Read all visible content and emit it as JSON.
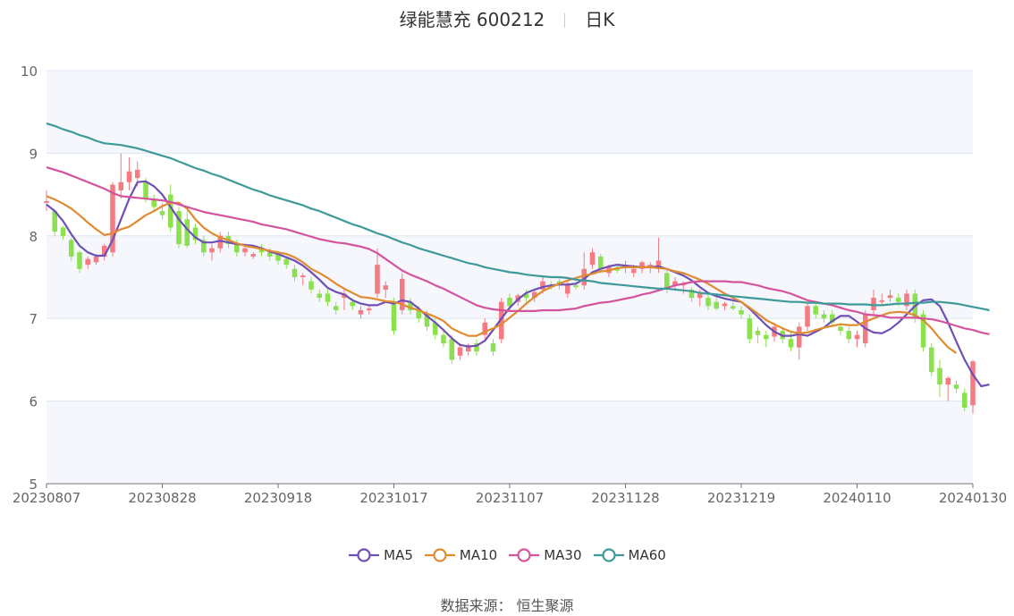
{
  "title": {
    "name": "绿能慧充 600212",
    "period": "日K"
  },
  "source": {
    "label": "数据来源：",
    "value": "恒生聚源"
  },
  "chart_data": {
    "type": "candlestick",
    "ylim": [
      5,
      10
    ],
    "yticks": [
      5,
      6,
      7,
      8,
      9,
      10
    ],
    "xtick_labels": [
      "20230807",
      "20230828",
      "20230918",
      "20231017",
      "20231107",
      "20231128",
      "20231219",
      "20240110",
      "20240130"
    ],
    "candles_ohlc": [
      [
        8.4,
        8.55,
        8.3,
        8.42
      ],
      [
        8.3,
        8.32,
        8.0,
        8.05
      ],
      [
        8.1,
        8.12,
        7.95,
        8.0
      ],
      [
        7.95,
        7.98,
        7.7,
        7.75
      ],
      [
        7.8,
        7.82,
        7.55,
        7.6
      ],
      [
        7.65,
        7.75,
        7.6,
        7.72
      ],
      [
        7.68,
        7.78,
        7.65,
        7.75
      ],
      [
        7.75,
        7.9,
        7.7,
        7.88
      ],
      [
        7.8,
        8.65,
        7.75,
        8.62
      ],
      [
        8.55,
        9.0,
        8.45,
        8.65
      ],
      [
        8.65,
        8.95,
        8.55,
        8.78
      ],
      [
        8.7,
        8.9,
        8.6,
        8.8
      ],
      [
        8.65,
        8.7,
        8.4,
        8.45
      ],
      [
        8.45,
        8.5,
        8.3,
        8.35
      ],
      [
        8.3,
        8.4,
        8.2,
        8.25
      ],
      [
        8.5,
        8.62,
        8.05,
        8.1
      ],
      [
        8.3,
        8.35,
        7.85,
        7.9
      ],
      [
        8.2,
        8.3,
        7.85,
        7.88
      ],
      [
        8.1,
        8.15,
        7.9,
        7.95
      ],
      [
        7.95,
        8.0,
        7.75,
        7.8
      ],
      [
        7.8,
        7.9,
        7.7,
        7.85
      ],
      [
        7.85,
        8.05,
        7.8,
        8.0
      ],
      [
        8.0,
        8.05,
        7.85,
        7.9
      ],
      [
        7.9,
        7.95,
        7.75,
        7.8
      ],
      [
        7.8,
        7.9,
        7.75,
        7.85
      ],
      [
        7.75,
        7.8,
        7.72,
        7.78
      ],
      [
        7.85,
        7.9,
        7.75,
        7.8
      ],
      [
        7.8,
        7.85,
        7.7,
        7.75
      ],
      [
        7.78,
        7.82,
        7.65,
        7.7
      ],
      [
        7.72,
        7.75,
        7.6,
        7.65
      ],
      [
        7.6,
        7.65,
        7.45,
        7.5
      ],
      [
        7.5,
        7.55,
        7.4,
        7.52
      ],
      [
        7.45,
        7.5,
        7.3,
        7.35
      ],
      [
        7.3,
        7.35,
        7.2,
        7.25
      ],
      [
        7.3,
        7.35,
        7.15,
        7.2
      ],
      [
        7.15,
        7.2,
        7.05,
        7.1
      ],
      [
        7.25,
        7.35,
        7.1,
        7.3
      ],
      [
        7.2,
        7.25,
        7.1,
        7.15
      ],
      [
        7.05,
        7.15,
        7.0,
        7.1
      ],
      [
        7.1,
        7.15,
        7.05,
        7.12
      ],
      [
        7.3,
        7.85,
        7.25,
        7.65
      ],
      [
        7.35,
        7.45,
        7.25,
        7.4
      ],
      [
        7.2,
        7.25,
        6.8,
        6.85
      ],
      [
        7.1,
        7.55,
        7.05,
        7.48
      ],
      [
        7.2,
        7.25,
        7.05,
        7.1
      ],
      [
        7.1,
        7.15,
        6.95,
        7.0
      ],
      [
        7.05,
        7.1,
        6.85,
        6.9
      ],
      [
        6.95,
        7.0,
        6.75,
        6.8
      ],
      [
        6.8,
        6.85,
        6.65,
        6.7
      ],
      [
        6.75,
        6.8,
        6.45,
        6.5
      ],
      [
        6.55,
        6.7,
        6.5,
        6.65
      ],
      [
        6.6,
        6.7,
        6.55,
        6.68
      ],
      [
        6.7,
        6.75,
        6.55,
        6.6
      ],
      [
        6.8,
        7.0,
        6.75,
        6.95
      ],
      [
        6.7,
        6.75,
        6.55,
        6.6
      ],
      [
        6.75,
        7.25,
        6.7,
        7.2
      ],
      [
        7.25,
        7.3,
        7.1,
        7.15
      ],
      [
        7.2,
        7.3,
        7.15,
        7.28
      ],
      [
        7.3,
        7.35,
        7.2,
        7.25
      ],
      [
        7.25,
        7.35,
        7.2,
        7.32
      ],
      [
        7.35,
        7.5,
        7.3,
        7.45
      ],
      [
        7.4,
        7.45,
        7.35,
        7.38
      ],
      [
        7.45,
        7.5,
        7.35,
        7.4
      ],
      [
        7.3,
        7.45,
        7.25,
        7.42
      ],
      [
        7.4,
        7.45,
        7.35,
        7.38
      ],
      [
        7.4,
        7.8,
        7.35,
        7.6
      ],
      [
        7.65,
        7.85,
        7.6,
        7.8
      ],
      [
        7.75,
        7.78,
        7.55,
        7.6
      ],
      [
        7.55,
        7.65,
        7.5,
        7.62
      ],
      [
        7.6,
        7.65,
        7.55,
        7.58
      ],
      [
        7.62,
        7.7,
        7.55,
        7.65
      ],
      [
        7.55,
        7.65,
        7.5,
        7.6
      ],
      [
        7.6,
        7.7,
        7.55,
        7.68
      ],
      [
        7.62,
        7.68,
        7.55,
        7.65
      ],
      [
        7.6,
        7.98,
        7.55,
        7.7
      ],
      [
        7.55,
        7.6,
        7.3,
        7.35
      ],
      [
        7.4,
        7.5,
        7.35,
        7.45
      ],
      [
        7.4,
        7.45,
        7.3,
        7.42
      ],
      [
        7.35,
        7.38,
        7.2,
        7.25
      ],
      [
        7.25,
        7.35,
        7.15,
        7.3
      ],
      [
        7.25,
        7.3,
        7.1,
        7.15
      ],
      [
        7.2,
        7.25,
        7.1,
        7.12
      ],
      [
        7.15,
        7.2,
        7.1,
        7.18
      ],
      [
        7.15,
        7.2,
        7.1,
        7.12
      ],
      [
        7.1,
        7.15,
        7.0,
        7.05
      ],
      [
        7.0,
        7.05,
        6.7,
        6.75
      ],
      [
        6.85,
        6.9,
        6.7,
        6.8
      ],
      [
        6.8,
        6.85,
        6.65,
        6.75
      ],
      [
        6.78,
        6.95,
        6.72,
        6.9
      ],
      [
        6.85,
        6.9,
        6.7,
        6.75
      ],
      [
        6.75,
        6.85,
        6.6,
        6.65
      ],
      [
        6.65,
        6.95,
        6.5,
        6.9
      ],
      [
        6.9,
        7.2,
        6.85,
        7.15
      ],
      [
        7.15,
        7.2,
        7.0,
        7.05
      ],
      [
        7.05,
        7.1,
        6.95,
        7.0
      ],
      [
        7.05,
        7.1,
        6.9,
        6.95
      ],
      [
        6.9,
        6.95,
        6.8,
        6.85
      ],
      [
        6.85,
        6.9,
        6.7,
        6.75
      ],
      [
        6.75,
        6.85,
        6.65,
        6.8
      ],
      [
        6.7,
        7.1,
        6.65,
        7.05
      ],
      [
        7.1,
        7.35,
        7.05,
        7.25
      ],
      [
        7.2,
        7.3,
        7.15,
        7.22
      ],
      [
        7.25,
        7.35,
        7.2,
        7.28
      ],
      [
        7.25,
        7.3,
        7.15,
        7.2
      ],
      [
        7.15,
        7.35,
        7.1,
        7.3
      ],
      [
        7.3,
        7.35,
        6.95,
        7.0
      ],
      [
        7.05,
        7.1,
        6.6,
        6.65
      ],
      [
        6.65,
        6.7,
        6.3,
        6.35
      ],
      [
        6.4,
        6.5,
        6.05,
        6.2
      ],
      [
        6.2,
        6.3,
        6.0,
        6.28
      ],
      [
        6.2,
        6.25,
        6.1,
        6.15
      ],
      [
        6.1,
        6.15,
        5.88,
        5.92
      ],
      [
        5.95,
        6.5,
        5.85,
        6.48
      ]
    ],
    "series": [
      {
        "name": "MA5",
        "color": "#6f4fb5",
        "values": [
          8.38,
          8.3,
          8.18,
          8.02,
          7.88,
          7.8,
          7.76,
          7.76,
          7.95,
          8.2,
          8.45,
          8.65,
          8.66,
          8.6,
          8.5,
          8.35,
          8.2,
          8.08,
          7.98,
          7.92,
          7.92,
          7.94,
          7.92,
          7.9,
          7.89,
          7.88,
          7.85,
          7.81,
          7.78,
          7.74,
          7.7,
          7.64,
          7.56,
          7.47,
          7.37,
          7.32,
          7.29,
          7.22,
          7.18,
          7.16,
          7.16,
          7.2,
          7.18,
          7.22,
          7.2,
          7.12,
          7.03,
          6.95,
          6.86,
          6.76,
          6.68,
          6.66,
          6.67,
          6.73,
          6.86,
          7.0,
          7.13,
          7.23,
          7.31,
          7.35,
          7.38,
          7.4,
          7.41,
          7.41,
          7.42,
          7.48,
          7.56,
          7.6,
          7.63,
          7.65,
          7.64,
          7.63,
          7.62,
          7.62,
          7.63,
          7.6,
          7.56,
          7.52,
          7.46,
          7.38,
          7.31,
          7.27,
          7.24,
          7.22,
          7.2,
          7.12,
          7.02,
          6.92,
          6.84,
          6.79,
          6.79,
          6.81,
          6.79,
          6.84,
          6.89,
          6.97,
          7.03,
          7.03,
          6.96,
          6.88,
          6.83,
          6.82,
          6.87,
          6.95,
          7.05,
          7.15,
          7.22,
          7.23,
          7.15,
          6.95,
          6.72,
          6.5,
          6.32,
          6.18,
          6.2
        ]
      },
      {
        "name": "MA10",
        "color": "#e08b2f",
        "values": [
          8.48,
          8.44,
          8.39,
          8.33,
          8.25,
          8.16,
          8.08,
          8.01,
          8.03,
          8.08,
          8.11,
          8.18,
          8.25,
          8.3,
          8.36,
          8.4,
          8.4,
          8.33,
          8.2,
          8.1,
          8.03,
          7.98,
          7.95,
          7.91,
          7.88,
          7.86,
          7.84,
          7.82,
          7.8,
          7.78,
          7.74,
          7.68,
          7.6,
          7.55,
          7.49,
          7.42,
          7.36,
          7.31,
          7.26,
          7.25,
          7.23,
          7.21,
          7.2,
          7.17,
          7.13,
          7.1,
          7.06,
          7.02,
          6.97,
          6.88,
          6.83,
          6.79,
          6.79,
          6.84,
          6.88,
          6.93,
          7.01,
          7.09,
          7.18,
          7.26,
          7.33,
          7.38,
          7.42,
          7.46,
          7.49,
          7.52,
          7.54,
          7.57,
          7.58,
          7.61,
          7.62,
          7.62,
          7.62,
          7.62,
          7.61,
          7.6,
          7.57,
          7.55,
          7.51,
          7.47,
          7.42,
          7.36,
          7.3,
          7.25,
          7.2,
          7.13,
          7.06,
          6.98,
          6.93,
          6.88,
          6.84,
          6.82,
          6.83,
          6.86,
          6.89,
          6.91,
          6.93,
          6.92,
          6.92,
          6.96,
          7.0,
          7.04,
          7.07,
          7.08,
          7.07,
          7.04,
          6.98,
          6.88,
          6.76,
          6.65,
          6.58
        ]
      },
      {
        "name": "MA30",
        "color": "#d4539c",
        "values": [
          8.83,
          8.8,
          8.77,
          8.73,
          8.69,
          8.65,
          8.61,
          8.57,
          8.52,
          8.48,
          8.47,
          8.46,
          8.45,
          8.44,
          8.43,
          8.41,
          8.38,
          8.35,
          8.32,
          8.29,
          8.27,
          8.25,
          8.23,
          8.21,
          8.19,
          8.17,
          8.14,
          8.12,
          8.1,
          8.08,
          8.05,
          8.02,
          7.99,
          7.96,
          7.94,
          7.92,
          7.91,
          7.89,
          7.87,
          7.84,
          7.79,
          7.72,
          7.65,
          7.58,
          7.53,
          7.49,
          7.45,
          7.4,
          7.36,
          7.31,
          7.26,
          7.21,
          7.16,
          7.13,
          7.11,
          7.1,
          7.09,
          7.09,
          7.09,
          7.09,
          7.1,
          7.1,
          7.1,
          7.11,
          7.12,
          7.15,
          7.17,
          7.19,
          7.2,
          7.22,
          7.24,
          7.26,
          7.29,
          7.31,
          7.34,
          7.37,
          7.4,
          7.42,
          7.44,
          7.45,
          7.45,
          7.45,
          7.45,
          7.44,
          7.44,
          7.42,
          7.4,
          7.37,
          7.35,
          7.33,
          7.3,
          7.26,
          7.22,
          7.2,
          7.18,
          7.16,
          7.13,
          7.1,
          7.08,
          7.05,
          7.04,
          7.03,
          7.01,
          7.01,
          7.01,
          7.01,
          7.0,
          6.99,
          6.97,
          6.94,
          6.91,
          6.88,
          6.86,
          6.83,
          6.81
        ]
      },
      {
        "name": "MA60",
        "color": "#3e9a9a",
        "values": [
          9.36,
          9.33,
          9.29,
          9.26,
          9.22,
          9.19,
          9.15,
          9.12,
          9.11,
          9.1,
          9.08,
          9.06,
          9.03,
          9.0,
          8.97,
          8.94,
          8.9,
          8.86,
          8.82,
          8.79,
          8.75,
          8.72,
          8.68,
          8.64,
          8.6,
          8.56,
          8.53,
          8.49,
          8.46,
          8.43,
          8.4,
          8.37,
          8.33,
          8.3,
          8.26,
          8.22,
          8.18,
          8.14,
          8.11,
          8.07,
          8.03,
          8.0,
          7.96,
          7.92,
          7.89,
          7.85,
          7.82,
          7.79,
          7.76,
          7.73,
          7.7,
          7.67,
          7.65,
          7.62,
          7.6,
          7.58,
          7.56,
          7.55,
          7.53,
          7.52,
          7.51,
          7.5,
          7.5,
          7.49,
          7.47,
          7.46,
          7.45,
          7.43,
          7.42,
          7.41,
          7.4,
          7.39,
          7.38,
          7.37,
          7.36,
          7.36,
          7.35,
          7.34,
          7.33,
          7.31,
          7.3,
          7.29,
          7.28,
          7.27,
          7.26,
          7.25,
          7.24,
          7.23,
          7.22,
          7.21,
          7.2,
          7.2,
          7.19,
          7.19,
          7.18,
          7.18,
          7.18,
          7.17,
          7.17,
          7.17,
          7.16,
          7.16,
          7.17,
          7.18,
          7.18,
          7.19,
          7.19,
          7.2,
          7.2,
          7.19,
          7.18,
          7.16,
          7.14,
          7.12,
          7.1
        ]
      }
    ],
    "up_color": "#f47b82",
    "down_color": "#8be04e",
    "grid": true,
    "legend_position": "bottom-center",
    "grid_color": "#dfe6f1",
    "band_color": "#f5f7fc"
  }
}
